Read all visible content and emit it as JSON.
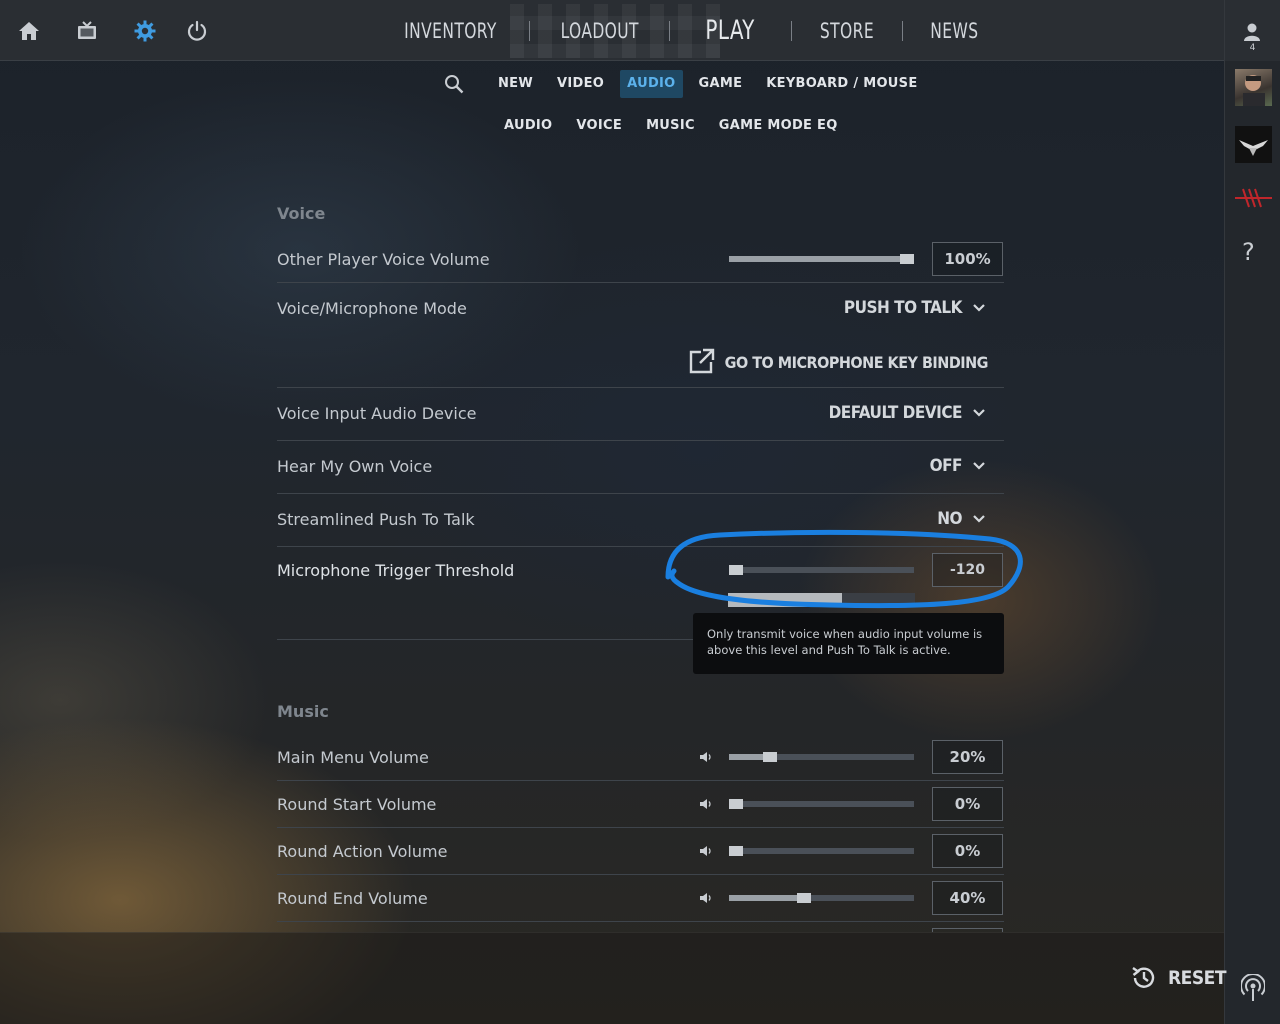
{
  "colors": {
    "accent": "#5cb2ec",
    "annotation": "#1a7fe0",
    "active_tab_bg": "#1f4863"
  },
  "top_icons": [
    "home-icon",
    "tv-icon",
    "gear-icon",
    "power-icon"
  ],
  "main_nav": {
    "inventory": "INVENTORY",
    "loadout": "LOADOUT",
    "play": "PLAY",
    "store": "STORE",
    "news": "NEWS"
  },
  "friends": {
    "count": "4"
  },
  "subnav": {
    "tabs": [
      "NEW",
      "VIDEO",
      "AUDIO",
      "GAME",
      "KEYBOARD / MOUSE"
    ],
    "active": "AUDIO",
    "sub_tabs": [
      "AUDIO",
      "VOICE",
      "MUSIC",
      "GAME MODE EQ"
    ]
  },
  "voice": {
    "title": "Voice",
    "other_player_volume": {
      "label": "Other Player Voice Volume",
      "value": "100%",
      "level": 1.0
    },
    "mic_mode": {
      "label": "Voice/Microphone Mode",
      "value": "PUSH TO TALK"
    },
    "key_binding_link": "GO TO MICROPHONE KEY BINDING",
    "input_device": {
      "label": "Voice Input Audio Device",
      "value": "DEFAULT DEVICE"
    },
    "hear_own_voice": {
      "label": "Hear My Own Voice",
      "value": "OFF"
    },
    "streamlined_ptt": {
      "label": "Streamlined Push To Talk",
      "value": "NO"
    },
    "mic_threshold": {
      "label": "Microphone Trigger Threshold",
      "value": "-120",
      "level": 0.0,
      "input_meter": 0.61
    },
    "tooltip": "Only transmit voice when audio input volume is above this level and Push To Talk is active."
  },
  "music": {
    "title": "Music",
    "main_menu": {
      "label": "Main Menu Volume",
      "value": "20%",
      "level": 0.2
    },
    "round_start": {
      "label": "Round Start Volume",
      "value": "0%",
      "level": 0.0
    },
    "round_action": {
      "label": "Round Action Volume",
      "value": "0%",
      "level": 0.0
    },
    "round_end": {
      "label": "Round End Volume",
      "value": "40%",
      "level": 0.4
    }
  },
  "reset_label": "RESET"
}
